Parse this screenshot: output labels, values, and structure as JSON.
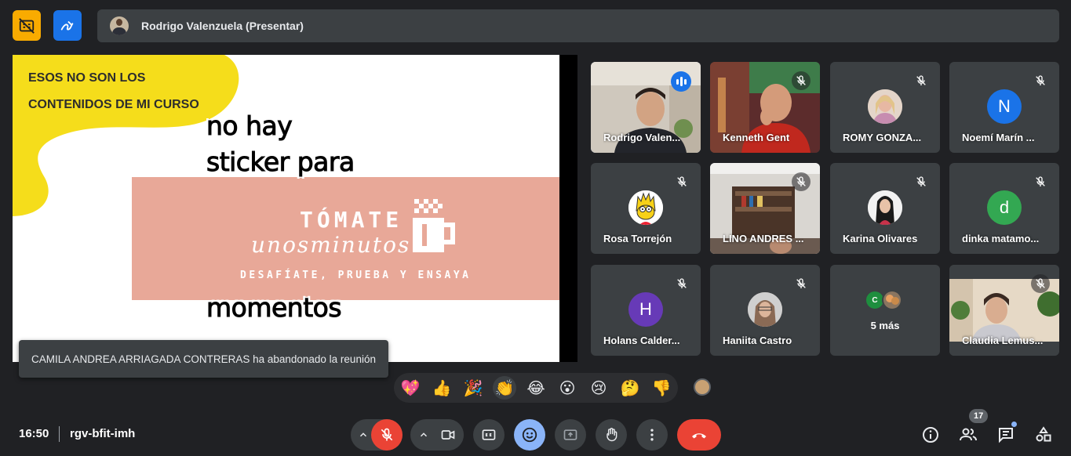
{
  "presenter": {
    "name": "Rodrigo Valenzuela (Presentar)"
  },
  "slide": {
    "heading_line1": "ESOS NO SON LOS",
    "heading_line2": "CONTENIDOS DE MI CURSO",
    "sticker_line1": "no hay",
    "sticker_line2": "sticker para",
    "sticker_line3": "momentos",
    "band_title": "TÓMATE",
    "band_script": "unosminutos",
    "band_subtitle": "DESAFÍATE, PRUEBA Y ENSAYA"
  },
  "toast": {
    "message": "CAMILA ANDREA ARRIAGADA CONTRERAS ha abandonado la reunión"
  },
  "participants": [
    {
      "name": "Rodrigo Valen...",
      "kind": "video",
      "speaking": true
    },
    {
      "name": "Kenneth Gent",
      "kind": "video",
      "muted": true
    },
    {
      "name": "ROMY GONZA...",
      "kind": "photo",
      "muted": true
    },
    {
      "name": "Noemí Marín ...",
      "kind": "initial",
      "initial": "N",
      "color": "#1a73e8",
      "muted": true
    },
    {
      "name": "Rosa Torrejón",
      "kind": "photo",
      "muted": true
    },
    {
      "name": "LINO ANDRES ...",
      "kind": "video",
      "muted": true
    },
    {
      "name": "Karina Olivares",
      "kind": "photo",
      "muted": true
    },
    {
      "name": "dinka matamo...",
      "kind": "initial",
      "initial": "d",
      "color": "#33a852",
      "muted": true
    },
    {
      "name": "Holans Calder...",
      "kind": "initial",
      "initial": "H",
      "color": "#673ab7",
      "muted": true
    },
    {
      "name": "Haniita Castro",
      "kind": "photo",
      "muted": true
    },
    {
      "name": "5 más",
      "kind": "more",
      "mini_initial": "C"
    },
    {
      "name": "Claudia Lemus...",
      "kind": "video",
      "muted": true
    }
  ],
  "reactions": [
    {
      "name": "sparkling-heart",
      "glyph": "💖"
    },
    {
      "name": "thumbs-up",
      "glyph": "👍"
    },
    {
      "name": "party-popper",
      "glyph": "🎉"
    },
    {
      "name": "clapping-hands",
      "glyph": "👏"
    },
    {
      "name": "tears-of-joy",
      "glyph": "😂"
    },
    {
      "name": "surprised",
      "glyph": "😮"
    },
    {
      "name": "crying",
      "glyph": "😢"
    },
    {
      "name": "thinking",
      "glyph": "🤔"
    },
    {
      "name": "thumbs-down",
      "glyph": "👎"
    }
  ],
  "footer": {
    "time": "16:50",
    "meeting_code": "rgv-bfit-imh",
    "participant_count": "17"
  },
  "colors": {
    "background": "#202124",
    "surface": "#3c4043",
    "accent": "#8ab4f8",
    "danger": "#ea4335",
    "slide_yellow": "#f5dd1b",
    "slide_pink": "#e8a898"
  }
}
